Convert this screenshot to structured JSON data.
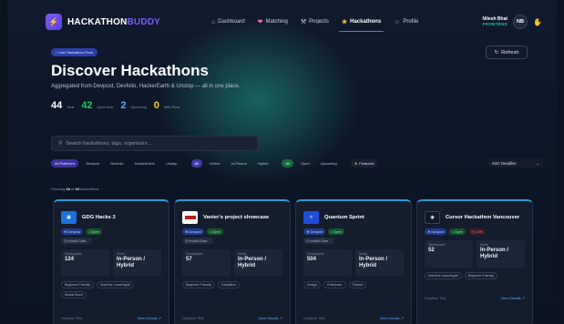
{
  "nav": {
    "brand_a": "HACKATHON",
    "brand_b": "BUDDY",
    "links": [
      {
        "label": "Dashboard",
        "icon": "home-icon"
      },
      {
        "label": "Matching",
        "icon": "heart-icon"
      },
      {
        "label": "Projects",
        "icon": "tools-icon"
      },
      {
        "label": "Hackathons",
        "icon": "trophy-icon"
      },
      {
        "label": "Profile",
        "icon": "user-icon"
      }
    ],
    "active_link": "Hackathons",
    "user_name": "Nilesh Bhat",
    "user_role": "FRONTEND",
    "avatar_initials": "NB"
  },
  "hero": {
    "feed_pill": "Live Hackathon Feed",
    "refresh_label": "Refresh",
    "title": "Discover Hackathons",
    "subtitle": "Aggregated from Devpost, Devfolio, HackerEarth & Unstop — all in one place.",
    "stats": [
      {
        "value": "44",
        "label": "Total",
        "color": "#ffffff"
      },
      {
        "value": "42",
        "label": "Open Now",
        "color": "#22c55e"
      },
      {
        "value": "2",
        "label": "Upcoming",
        "color": "#60a5fa"
      },
      {
        "value": "0",
        "label": "With Prize",
        "color": "#facc15"
      }
    ]
  },
  "search": {
    "placeholder": "Search hackathons, tags, organizers..."
  },
  "filters": {
    "platforms": [
      "All Platforms",
      "Devpost",
      "Devfolio",
      "HackerEarth",
      "Unstop"
    ],
    "modes": [
      "All",
      "Online",
      "In-Person",
      "Hybrid"
    ],
    "status": [
      "All",
      "Open",
      "Upcoming"
    ],
    "featured": "Featured",
    "sort": "Sort: Deadline"
  },
  "showing": {
    "prefix": "Showing",
    "count": "44",
    "middle": "of",
    "total": "44",
    "suffix": "hackathons"
  },
  "cards": [
    {
      "title": "GDG Hacks 3",
      "source": "Devpost",
      "status": "Open",
      "extra_badge": "",
      "date": "Invalid Date",
      "participants_label": "Participants",
      "participants": "124",
      "mode_label": "Mode",
      "mode": "In-Person / Hybrid",
      "tags": [
        "Beginner Friendly",
        "Machine Learning/AI",
        "Social Good"
      ],
      "deadline": "Deadline TBA",
      "details_label": "View Details"
    },
    {
      "title": "Vanier's project showcase",
      "source": "Devpost",
      "status": "Open",
      "extra_badge": "",
      "date": "Invalid Date",
      "participants_label": "Participants",
      "participants": "57",
      "mode_label": "Mode",
      "mode": "In-Person / Hybrid",
      "tags": [
        "Beginner Friendly",
        "Education"
      ],
      "deadline": "Deadline TBA",
      "details_label": "View Details"
    },
    {
      "title": "Quantum Sprint",
      "source": "Devpost",
      "status": "Open",
      "extra_badge": "",
      "date": "Invalid Date",
      "participants_label": "Participants",
      "participants": "504",
      "mode_label": "Mode",
      "mode": "In-Person / Hybrid",
      "tags": [
        "Design",
        "Enterprise",
        "Fintech"
      ],
      "deadline": "Deadline TBA",
      "details_label": "View Details"
    },
    {
      "title": "Cursor Hackathon Vancouver",
      "source": "Devpost",
      "status": "Open",
      "extra_badge": "1 left",
      "date": "",
      "participants_label": "Participants",
      "participants": "52",
      "mode_label": "Mode",
      "mode": "In-Person / Hybrid",
      "tags": [
        "Machine Learning/AI",
        "Beginner Friendly"
      ],
      "deadline": "Deadline TBA",
      "details_label": "View Details"
    }
  ]
}
